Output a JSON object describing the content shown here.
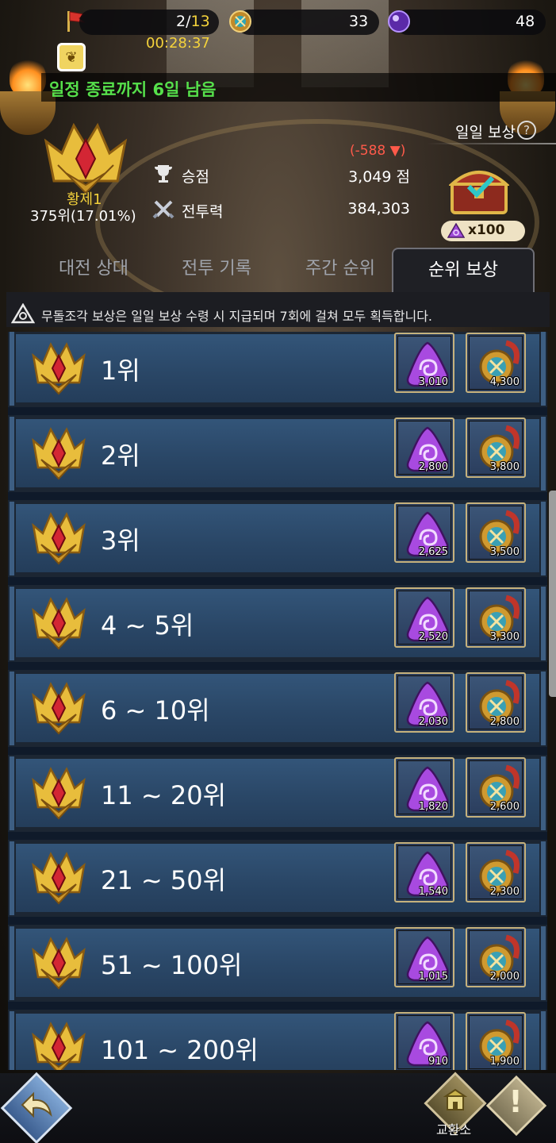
{
  "topbar": {
    "flag_icon": "red-flag-icon",
    "tickets_current": "2",
    "tickets_sep": "/",
    "tickets_max": "13",
    "medal_count": "33",
    "orb_count": "48",
    "timer": "00:28:37"
  },
  "season": {
    "badge_icon": "wheat-badge-icon",
    "remaining_text": "일정 종료까지 6일 남음"
  },
  "player": {
    "tier": "황제1",
    "rank": "375위(17.01%)",
    "score_diff": "(-588 ▼)",
    "score_label": "승점",
    "score_value": "3,049 점",
    "power_label": "전투력",
    "power_value": "384,303"
  },
  "daily": {
    "label": "일일 보상",
    "help": "?",
    "reward_count": "x100"
  },
  "tabs": [
    {
      "label": "대전 상대"
    },
    {
      "label": "전투 기록"
    },
    {
      "label": "주간 순위"
    },
    {
      "label": "순위 보상"
    }
  ],
  "notice": "무돌조각 보상은 일일 보상 수령 시 지급되며 7회에 걸쳐 모두 획득합니다.",
  "rewards": [
    {
      "rank": "1위",
      "stone": "3,010",
      "medal": "4,300"
    },
    {
      "rank": "2위",
      "stone": "2,800",
      "medal": "3,800"
    },
    {
      "rank": "3위",
      "stone": "2,625",
      "medal": "3,500"
    },
    {
      "rank": "4 ~ 5위",
      "stone": "2,520",
      "medal": "3,300"
    },
    {
      "rank": "6 ~ 10위",
      "stone": "2,030",
      "medal": "2,800"
    },
    {
      "rank": "11 ~ 20위",
      "stone": "1,820",
      "medal": "2,600"
    },
    {
      "rank": "21 ~ 50위",
      "stone": "1,540",
      "medal": "2,300"
    },
    {
      "rank": "51 ~ 100위",
      "stone": "1,015",
      "medal": "2,000"
    },
    {
      "rank": "101 ~ 200위",
      "stone": "910",
      "medal": "1,900"
    }
  ],
  "bottom": {
    "shop_label": "교환소"
  },
  "colors": {
    "timer": "#f5d33b",
    "season_text": "#56e04b",
    "tier": "#f2d03b",
    "score_diff": "#ff5a4a",
    "row_blue": "#2a4767"
  }
}
